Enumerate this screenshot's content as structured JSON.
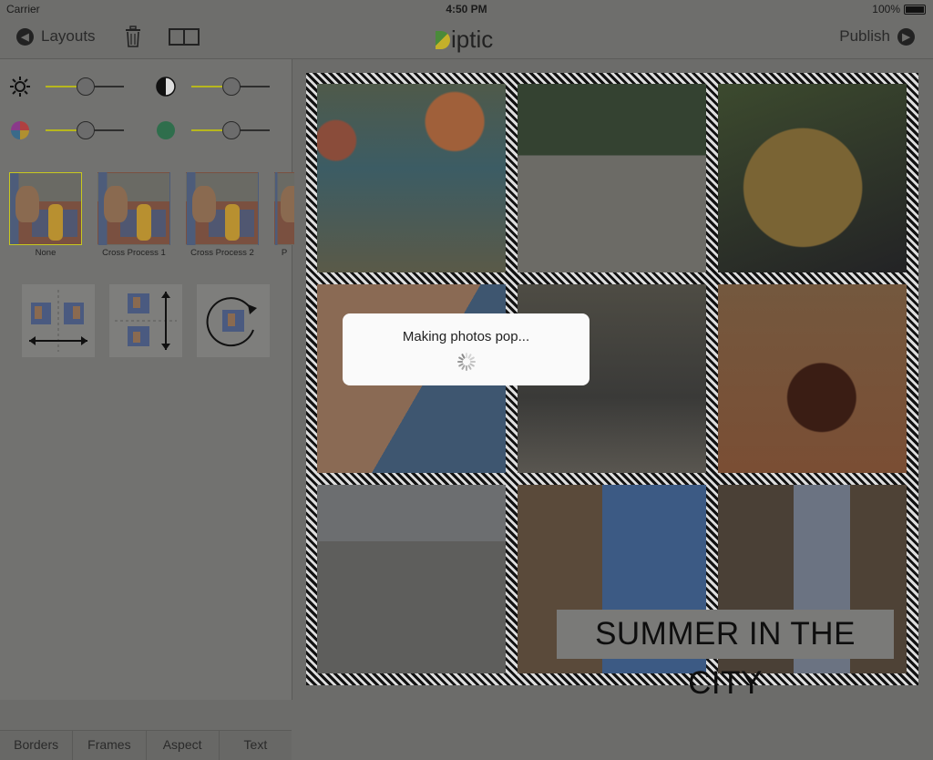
{
  "status_bar": {
    "carrier": "Carrier",
    "time": "4:50 PM",
    "battery": "100%"
  },
  "nav": {
    "back_label": "Layouts",
    "app_title": "iptic",
    "publish_label": "Publish"
  },
  "adjustments": [
    {
      "name": "brightness",
      "icon": "sun-icon",
      "value": 0.5
    },
    {
      "name": "contrast",
      "icon": "contrast-icon",
      "value": 0.5
    },
    {
      "name": "saturation",
      "icon": "color-wheel-icon",
      "value": 0.5
    },
    {
      "name": "tint",
      "icon": "tint-icon",
      "value": 0.5
    }
  ],
  "filters": [
    {
      "label": "None",
      "selected": true
    },
    {
      "label": "Cross Process 1",
      "selected": false
    },
    {
      "label": "Cross Process 2",
      "selected": false
    },
    {
      "label": "P",
      "selected": false
    }
  ],
  "tools": [
    "flip-horizontal-icon",
    "flip-vertical-icon",
    "rotate-icon"
  ],
  "tabs": [
    "Borders",
    "Frames",
    "Aspect",
    "Text"
  ],
  "caption": "SUMMER IN THE CITY",
  "hud": {
    "message": "Making photos pop..."
  },
  "colors": {
    "accent": "#c8c81e",
    "overlay": "#6c6c6a"
  }
}
